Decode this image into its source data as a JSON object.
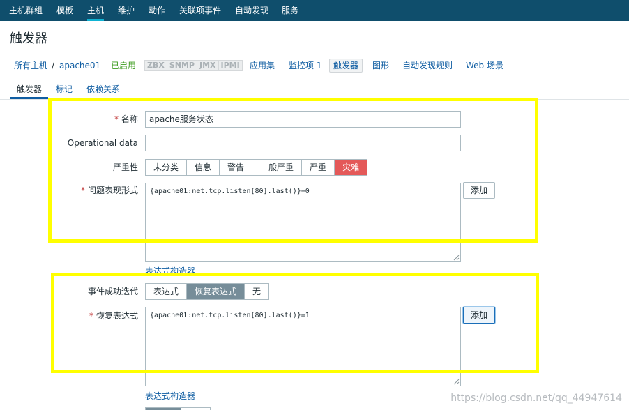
{
  "topnav": {
    "items": [
      "主机群组",
      "模板",
      "主机",
      "维护",
      "动作",
      "关联项事件",
      "自动发现",
      "服务"
    ],
    "active": "主机"
  },
  "page_title": "触发器",
  "hostbar": {
    "all_hosts": "所有主机",
    "separator": "/",
    "host": "apache01",
    "status": "已启用",
    "interfaces": [
      "ZBX",
      "SNMP",
      "JMX",
      "IPMI"
    ],
    "links": [
      "应用集",
      "监控项 1",
      "触发器",
      "图形",
      "自动发现规则",
      "Web 场景"
    ],
    "current": "触发器"
  },
  "subtabs": [
    "触发器",
    "标记",
    "依赖关系"
  ],
  "form": {
    "required_marker": "*",
    "name_label": "名称",
    "name_value": "apache服务状态",
    "opdata_label": "Operational data",
    "opdata_value": "",
    "severity_label": "严重性",
    "severity_options": [
      "未分类",
      "信息",
      "警告",
      "一般严重",
      "严重",
      "灾难"
    ],
    "severity_selected": "灾难",
    "problem_expr_label": "问题表现形式",
    "problem_expr_value": "{apache01:net.tcp.listen[80].last()}=0",
    "add_button": "添加",
    "expr_builder_link": "表达式构造器",
    "recovery_gen_label": "事件成功迭代",
    "recovery_gen_options": [
      "表达式",
      "恢复表达式",
      "无"
    ],
    "recovery_gen_selected": "恢复表达式",
    "recovery_expr_label": "恢复表达式",
    "recovery_expr_value": "{apache01:net.tcp.listen[80].last()}=1",
    "recovery_add_button": "添加",
    "recovery_builder_link": "表达式构造器"
  },
  "colors": {
    "nav_bg": "#0f4e6c",
    "highlight": "#ffff00",
    "disaster": "#e45959",
    "selected_grey": "#768d99",
    "link": "#0f5da2",
    "enabled": "#3c9c1e"
  },
  "watermark": "https://blog.csdn.net/qq_44947614"
}
